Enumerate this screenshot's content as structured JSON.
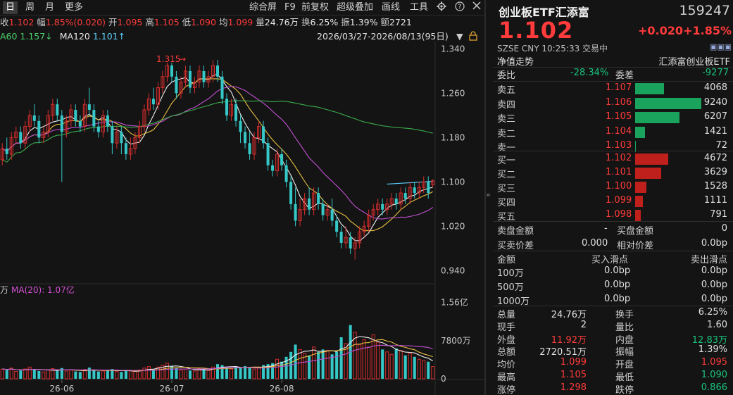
{
  "toolbar": {
    "tabs": [
      "日",
      "周",
      "月",
      "更多"
    ],
    "right_items": [
      "综合屏",
      "F9",
      "前复权",
      "超级叠加",
      "画线",
      "工具"
    ],
    "gear_icon": "gear-icon",
    "help_icon": "help-icon"
  },
  "quote_line": {
    "close_label": "收",
    "close_value": "1.102",
    "amp_label": "幅",
    "amp_value": "1.85%(0.020)",
    "open_label": "开",
    "open_value": "1.095",
    "high_label": "高",
    "high_value": "1.105",
    "low_label": "低",
    "low_value": "1.090",
    "avg_label": "均",
    "avg_value": "1.099",
    "vol_label": "量",
    "vol_value": "24.76万",
    "turn_label": "换",
    "turn_value": "6.25%",
    "swing_label": "振",
    "swing_value": "1.39%",
    "amount_label": "额",
    "amount_value": "2721"
  },
  "ma_line": {
    "ma60": "A60 1.157↓",
    "ma120_label": "MA120",
    "ma120_value": "1.101↑",
    "range": "2026/03/27-2026/08/13(95日)"
  },
  "chart_data": {
    "type": "candlestick",
    "price_ticks": [
      "1.340",
      "1.260",
      "1.180",
      "1.100",
      "1.020",
      "0.940"
    ],
    "price_tick_values": [
      1.34,
      1.26,
      1.18,
      1.1,
      1.02,
      0.94
    ],
    "vol_ticks": [
      "1.56亿",
      "7800万",
      "0"
    ],
    "vol_tick_values": [
      156000000,
      78000000,
      0
    ],
    "x_labels": [
      "26-06",
      "26-07",
      "26-08"
    ],
    "max_annotation": "1.315",
    "volume_legend_prefix": "万",
    "volume_legend": "MA(20): 1.07亿",
    "candles": [
      [
        1.14,
        1.16,
        1.17,
        1.13
      ],
      [
        1.16,
        1.15,
        1.18,
        1.14
      ],
      [
        1.15,
        1.18,
        1.19,
        1.14
      ],
      [
        1.18,
        1.19,
        1.2,
        1.17
      ],
      [
        1.19,
        1.17,
        1.2,
        1.16
      ],
      [
        1.17,
        1.2,
        1.21,
        1.16
      ],
      [
        1.2,
        1.22,
        1.23,
        1.19
      ],
      [
        1.22,
        1.21,
        1.24,
        1.2
      ],
      [
        1.21,
        1.18,
        1.22,
        1.17
      ],
      [
        1.18,
        1.19,
        1.2,
        1.17
      ],
      [
        1.19,
        1.22,
        1.23,
        1.18
      ],
      [
        1.22,
        1.24,
        1.25,
        1.21
      ],
      [
        1.24,
        1.22,
        1.25,
        1.21
      ],
      [
        1.22,
        1.19,
        1.23,
        1.1
      ],
      [
        1.19,
        1.21,
        1.22,
        1.18
      ],
      [
        1.21,
        1.23,
        1.24,
        1.2
      ],
      [
        1.23,
        1.21,
        1.24,
        1.2
      ],
      [
        1.21,
        1.2,
        1.22,
        1.19
      ],
      [
        1.2,
        1.24,
        1.25,
        1.19
      ],
      [
        1.24,
        1.23,
        1.27,
        1.22
      ],
      [
        1.23,
        1.2,
        1.24,
        1.19
      ],
      [
        1.2,
        1.19,
        1.21,
        1.18
      ],
      [
        1.19,
        1.22,
        1.23,
        1.18
      ],
      [
        1.22,
        1.2,
        1.23,
        1.19
      ],
      [
        1.2,
        1.17,
        1.21,
        1.15
      ],
      [
        1.17,
        1.19,
        1.2,
        1.16
      ],
      [
        1.19,
        1.17,
        1.2,
        1.15
      ],
      [
        1.17,
        1.15,
        1.18,
        1.14
      ],
      [
        1.15,
        1.16,
        1.18,
        1.14
      ],
      [
        1.16,
        1.18,
        1.19,
        1.15
      ],
      [
        1.18,
        1.2,
        1.21,
        1.17
      ],
      [
        1.2,
        1.23,
        1.24,
        1.19
      ],
      [
        1.23,
        1.25,
        1.26,
        1.22
      ],
      [
        1.25,
        1.24,
        1.27,
        1.23
      ],
      [
        1.24,
        1.27,
        1.28,
        1.23
      ],
      [
        1.27,
        1.29,
        1.3,
        1.26
      ],
      [
        1.29,
        1.31,
        1.315,
        1.28
      ],
      [
        1.31,
        1.29,
        1.315,
        1.28
      ],
      [
        1.29,
        1.26,
        1.3,
        1.25
      ],
      [
        1.26,
        1.28,
        1.29,
        1.25
      ],
      [
        1.28,
        1.3,
        1.31,
        1.27
      ],
      [
        1.3,
        1.27,
        1.31,
        1.26
      ],
      [
        1.27,
        1.28,
        1.29,
        1.26
      ],
      [
        1.28,
        1.3,
        1.31,
        1.27
      ],
      [
        1.3,
        1.28,
        1.31,
        1.27
      ],
      [
        1.28,
        1.29,
        1.3,
        1.27
      ],
      [
        1.29,
        1.31,
        1.32,
        1.28
      ],
      [
        1.31,
        1.29,
        1.32,
        1.28
      ],
      [
        1.29,
        1.25,
        1.3,
        1.24
      ],
      [
        1.25,
        1.22,
        1.26,
        1.21
      ],
      [
        1.22,
        1.24,
        1.25,
        1.21
      ],
      [
        1.24,
        1.21,
        1.25,
        1.2
      ],
      [
        1.21,
        1.19,
        1.22,
        1.17
      ],
      [
        1.19,
        1.17,
        1.2,
        1.16
      ],
      [
        1.17,
        1.15,
        1.19,
        1.14
      ],
      [
        1.15,
        1.18,
        1.19,
        1.14
      ],
      [
        1.18,
        1.2,
        1.21,
        1.17
      ],
      [
        1.2,
        1.17,
        1.21,
        1.16
      ],
      [
        1.17,
        1.13,
        1.18,
        1.12
      ],
      [
        1.13,
        1.12,
        1.14,
        1.11
      ],
      [
        1.12,
        1.15,
        1.16,
        1.11
      ],
      [
        1.15,
        1.13,
        1.16,
        1.12
      ],
      [
        1.13,
        1.1,
        1.14,
        1.09
      ],
      [
        1.1,
        1.06,
        1.11,
        1.05
      ],
      [
        1.06,
        1.03,
        1.09,
        1.02
      ],
      [
        1.03,
        1.05,
        1.07,
        1.02
      ],
      [
        1.05,
        1.07,
        1.08,
        1.04
      ],
      [
        1.07,
        1.05,
        1.09,
        1.04
      ],
      [
        1.05,
        1.08,
        1.09,
        1.04
      ],
      [
        1.08,
        1.06,
        1.09,
        1.05
      ],
      [
        1.06,
        1.04,
        1.07,
        1.03
      ],
      [
        1.04,
        1.05,
        1.06,
        1.03
      ],
      [
        1.05,
        1.03,
        1.07,
        1.02
      ],
      [
        1.03,
        1.01,
        1.04,
        1.0
      ],
      [
        1.01,
        0.99,
        1.02,
        0.98
      ],
      [
        0.99,
        1.0,
        1.02,
        0.98
      ],
      [
        1.0,
        0.98,
        1.01,
        0.97
      ],
      [
        0.98,
        0.99,
        1.0,
        0.96
      ],
      [
        0.99,
        1.01,
        1.02,
        0.98
      ],
      [
        1.01,
        1.02,
        1.03,
        1.0
      ],
      [
        1.02,
        1.04,
        1.05,
        1.01
      ],
      [
        1.04,
        1.05,
        1.06,
        1.03
      ],
      [
        1.05,
        1.06,
        1.07,
        1.04
      ],
      [
        1.06,
        1.05,
        1.07,
        1.04
      ],
      [
        1.05,
        1.06,
        1.07,
        1.04
      ],
      [
        1.06,
        1.07,
        1.08,
        1.05
      ],
      [
        1.07,
        1.06,
        1.08,
        1.05
      ],
      [
        1.06,
        1.08,
        1.09,
        1.05
      ],
      [
        1.08,
        1.07,
        1.09,
        1.06
      ],
      [
        1.07,
        1.09,
        1.1,
        1.06
      ],
      [
        1.09,
        1.08,
        1.1,
        1.07
      ],
      [
        1.08,
        1.09,
        1.1,
        1.07
      ],
      [
        1.09,
        1.1,
        1.11,
        1.08
      ],
      [
        1.1,
        1.08,
        1.11,
        1.07
      ],
      [
        1.095,
        1.102,
        1.105,
        1.09
      ]
    ],
    "volumes": [
      20,
      18,
      22,
      15,
      17,
      20,
      24,
      19,
      16,
      14,
      18,
      21,
      17,
      22,
      16,
      18,
      15,
      14,
      19,
      23,
      17,
      15,
      16,
      18,
      20,
      15,
      14,
      17,
      16,
      15,
      18,
      22,
      25,
      19,
      24,
      28,
      32,
      26,
      22,
      18,
      20,
      17,
      16,
      21,
      19,
      17,
      24,
      30,
      28,
      22,
      20,
      25,
      22,
      26,
      24,
      20,
      23,
      28,
      30,
      32,
      40,
      35,
      45,
      55,
      70,
      60,
      52,
      48,
      65,
      55,
      60,
      58,
      50,
      55,
      85,
      72,
      110,
      95,
      70,
      80,
      65,
      90,
      75,
      60,
      55,
      50,
      62,
      58,
      48,
      52,
      45,
      40,
      38,
      35,
      25
    ]
  },
  "info": {
    "title": "创业板ETF汇添富",
    "code": "159247",
    "price": "1.102",
    "change": "+0.020",
    "change_pct": "+1.85%",
    "exchange": "SZSE",
    "currency": "CNY",
    "time": "10:25:33",
    "status": "交易中",
    "nav_label": "净值走势",
    "nav_name": "汇添富创业板ETF",
    "weibi_label": "委比",
    "weibi_value": "-28.34%",
    "weicha_label": "委差",
    "weicha_value": "-9277"
  },
  "order_book": {
    "asks": [
      {
        "label": "卖五",
        "price": "1.107",
        "vol": "4068",
        "ratio": 0.44
      },
      {
        "label": "卖四",
        "price": "1.106",
        "vol": "9240",
        "ratio": 1.0
      },
      {
        "label": "卖三",
        "price": "1.105",
        "vol": "6207",
        "ratio": 0.67
      },
      {
        "label": "卖二",
        "price": "1.104",
        "vol": "1421",
        "ratio": 0.15
      },
      {
        "label": "卖一",
        "price": "1.103",
        "vol": "72",
        "ratio": 0.01
      }
    ],
    "bids": [
      {
        "label": "买一",
        "price": "1.102",
        "vol": "4672",
        "ratio": 0.5
      },
      {
        "label": "买二",
        "price": "1.101",
        "vol": "3629",
        "ratio": 0.39
      },
      {
        "label": "买三",
        "price": "1.100",
        "vol": "1528",
        "ratio": 0.17
      },
      {
        "label": "买四",
        "price": "1.099",
        "vol": "1111",
        "ratio": 0.12
      },
      {
        "label": "买五",
        "price": "1.098",
        "vol": "791",
        "ratio": 0.09
      }
    ]
  },
  "cash": {
    "sell_amount_label": "卖盘金额",
    "sell_amount_value": "-",
    "buy_amount_label": "买盘金额",
    "buy_amount_value": "0",
    "spread_label": "买卖价差",
    "spread_value": "0.000",
    "rel_spread_label": "相对价差",
    "rel_spread_value": "0.0bp"
  },
  "slippage": {
    "header": [
      "金额",
      "买入滑点",
      "卖出滑点"
    ],
    "rows": [
      [
        "100万",
        "0.0bp",
        "0.0bp"
      ],
      [
        "500万",
        "0.0bp",
        "0.0bp"
      ],
      [
        "1000万",
        "0.0bp",
        "0.0bp"
      ]
    ]
  },
  "stats": [
    [
      "总量",
      "24.76万",
      "换手",
      "6.25%"
    ],
    [
      "现手",
      "2",
      "量比",
      "1.60"
    ],
    [
      "外盘",
      "11.92万",
      "内盘",
      "12.83万"
    ],
    [
      "总额",
      "2720.51万",
      "振幅",
      "1.39%"
    ],
    [
      "均价",
      "1.099",
      "开盘",
      "1.095"
    ],
    [
      "最高",
      "1.105",
      "最低",
      "1.090"
    ],
    [
      "涨停",
      "1.298",
      "跌停",
      "0.866"
    ]
  ],
  "colors": {
    "up": "#ff3b3b",
    "down": "#19c37d",
    "candle_up": "#d62d2d",
    "candle_down": "#36c7c7",
    "ask_bar": "#1aa35c",
    "bid_bar": "#c0201c"
  }
}
